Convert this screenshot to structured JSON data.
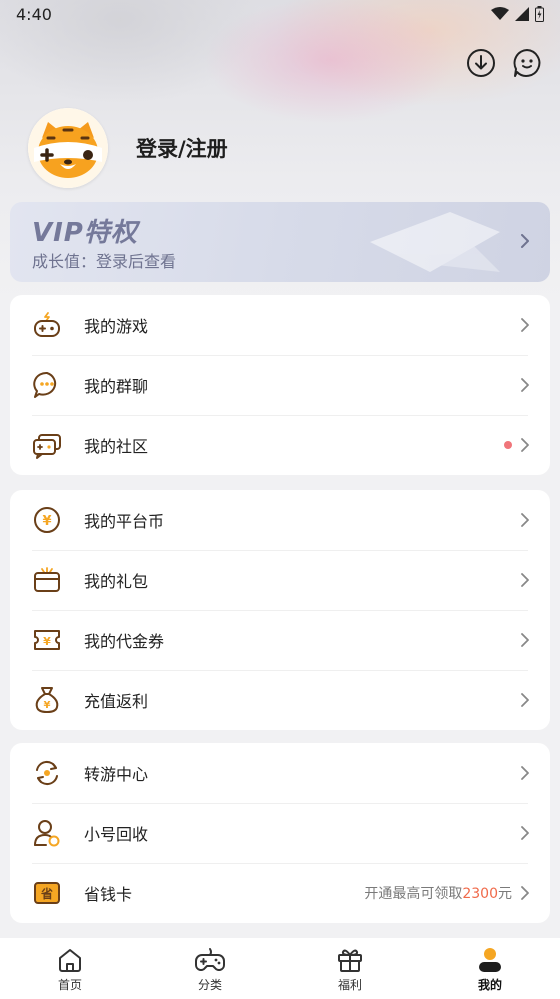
{
  "status": {
    "time": "4:40"
  },
  "profile": {
    "login_label": "登录/注册"
  },
  "vip": {
    "title": "VIP特权",
    "subtitle": "成长值：登录后查看"
  },
  "group1": [
    {
      "label": "我的游戏",
      "icon": "gamepad-icon"
    },
    {
      "label": "我的群聊",
      "icon": "chat-bubble-icon"
    },
    {
      "label": "我的社区",
      "icon": "community-icon",
      "badge": "red-dot"
    }
  ],
  "group2": [
    {
      "label": "我的平台币",
      "icon": "coin-icon"
    },
    {
      "label": "我的礼包",
      "icon": "gift-box-icon"
    },
    {
      "label": "我的代金券",
      "icon": "voucher-icon"
    },
    {
      "label": "充值返利",
      "icon": "money-bag-icon"
    }
  ],
  "group3": [
    {
      "label": "转游中心",
      "icon": "transfer-icon"
    },
    {
      "label": "小号回收",
      "icon": "account-recycle-icon"
    },
    {
      "label": "省钱卡",
      "icon": "saving-card-icon",
      "hint_prefix": "开通最高可领取",
      "hint_amount": "2300",
      "hint_suffix": "元"
    }
  ],
  "tabs": [
    {
      "label": "首页",
      "icon": "home-icon"
    },
    {
      "label": "分类",
      "icon": "gamepad-icon"
    },
    {
      "label": "福利",
      "icon": "gift-icon"
    },
    {
      "label": "我的",
      "icon": "user-icon",
      "active": true
    }
  ],
  "colors": {
    "accent": "#f5a623",
    "badge": "#f0757a",
    "highlight": "#f06a4a",
    "icon_brown": "#7a4a1e"
  }
}
